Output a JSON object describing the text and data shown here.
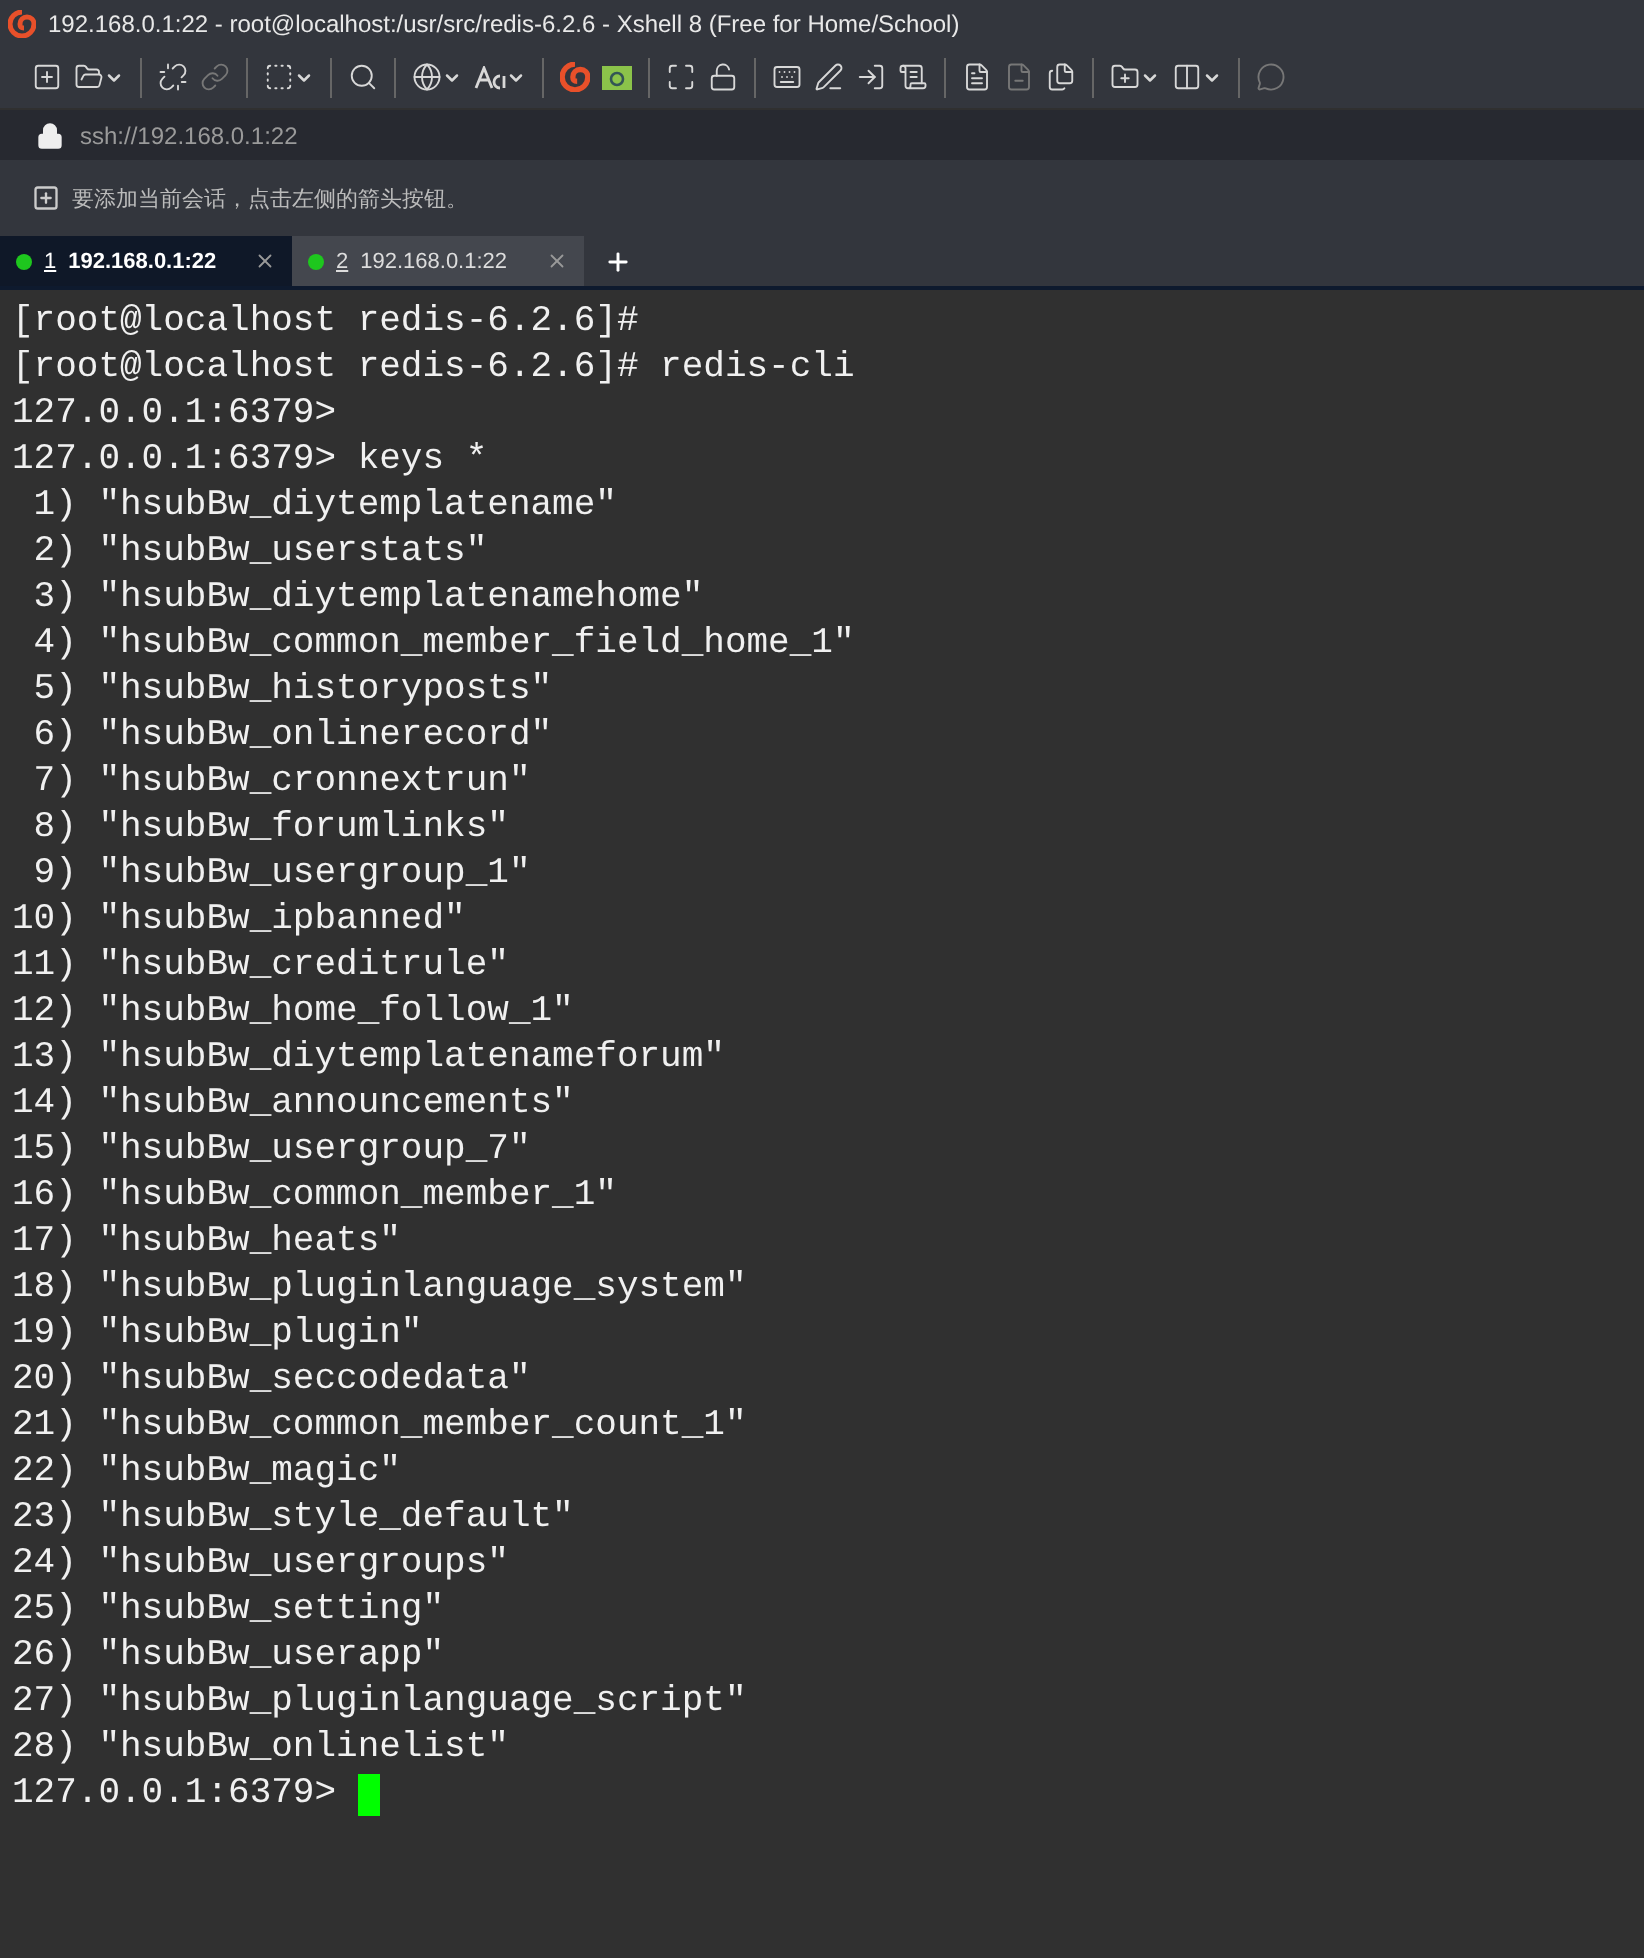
{
  "window": {
    "title": "192.168.0.1:22 - root@localhost:/usr/src/redis-6.2.6 - Xshell 8 (Free for Home/School)"
  },
  "address_bar": {
    "value": "ssh://192.168.0.1:22"
  },
  "hint_bar": {
    "text": "要添加当前会话，点击左侧的箭头按钮。"
  },
  "tabs": [
    {
      "number": "1",
      "label": "192.168.0.1:22",
      "selected": true,
      "connected": true
    },
    {
      "number": "2",
      "label": "192.168.0.1:22",
      "selected": false,
      "connected": true
    }
  ],
  "terminal": {
    "lines": [
      "[root@localhost redis-6.2.6]#",
      "[root@localhost redis-6.2.6]# redis-cli",
      "127.0.0.1:6379>",
      "127.0.0.1:6379> keys *",
      " 1) \"hsubBw_diytemplatename\"",
      " 2) \"hsubBw_userstats\"",
      " 3) \"hsubBw_diytemplatenamehome\"",
      " 4) \"hsubBw_common_member_field_home_1\"",
      " 5) \"hsubBw_historyposts\"",
      " 6) \"hsubBw_onlinerecord\"",
      " 7) \"hsubBw_cronnextrun\"",
      " 8) \"hsubBw_forumlinks\"",
      " 9) \"hsubBw_usergroup_1\"",
      "10) \"hsubBw_ipbanned\"",
      "11) \"hsubBw_creditrule\"",
      "12) \"hsubBw_home_follow_1\"",
      "13) \"hsubBw_diytemplatenameforum\"",
      "14) \"hsubBw_announcements\"",
      "15) \"hsubBw_usergroup_7\"",
      "16) \"hsubBw_common_member_1\"",
      "17) \"hsubBw_heats\"",
      "18) \"hsubBw_pluginlanguage_system\"",
      "19) \"hsubBw_plugin\"",
      "20) \"hsubBw_seccodedata\"",
      "21) \"hsubBw_common_member_count_1\"",
      "22) \"hsubBw_magic\"",
      "23) \"hsubBw_style_default\"",
      "24) \"hsubBw_usergroups\"",
      "25) \"hsubBw_setting\"",
      "26) \"hsubBw_userapp\"",
      "27) \"hsubBw_pluginlanguage_script\"",
      "28) \"hsubBw_onlinelist\"",
      "127.0.0.1:6379>"
    ]
  }
}
